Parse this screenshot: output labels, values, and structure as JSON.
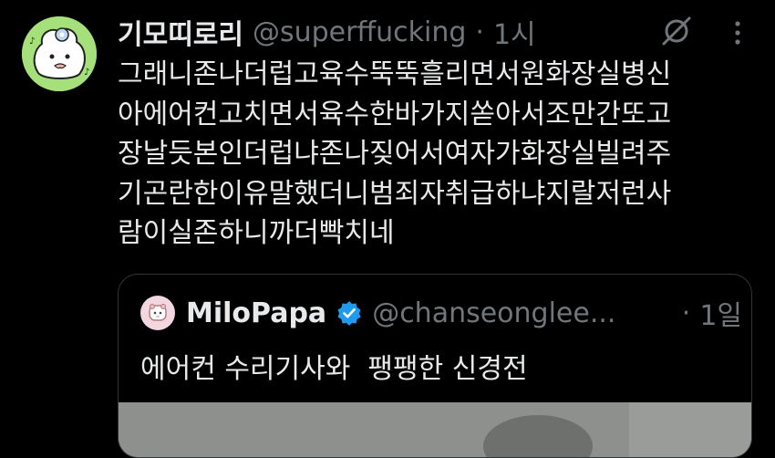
{
  "tweet": {
    "author_name": "기모띠로리",
    "author_handle": "@superffucking",
    "separator": "·",
    "time": "1시",
    "text_lines": [
      "그래니존나더럽고육수뚝뚝흘리면서원화장실병신",
      "아에어컨고치면서육수한바가지쏟아서조만간또고",
      "장날듯본인더럽냐존나짖어서여자가화장실빌려주",
      "기곤란한이유말했더니범죄자취급하냐지랄저런사",
      "람이실존하니까더빡치네"
    ]
  },
  "quote": {
    "author_name": "MiloPapa",
    "author_handle": "@chanseonglee...",
    "separator": "·",
    "time": "1일",
    "text": "에어컨 수리기사와  팽팽한 신경전"
  },
  "icons": {
    "mute": "mute-icon",
    "more": "more-options-icon",
    "verified": "verified-badge-icon"
  },
  "colors": {
    "background": "#000000",
    "text": "#e7e9ea",
    "secondary": "#71767b",
    "verified": "#1d9bf0",
    "avatar_bg": "#a6e07a",
    "border": "#333639"
  }
}
